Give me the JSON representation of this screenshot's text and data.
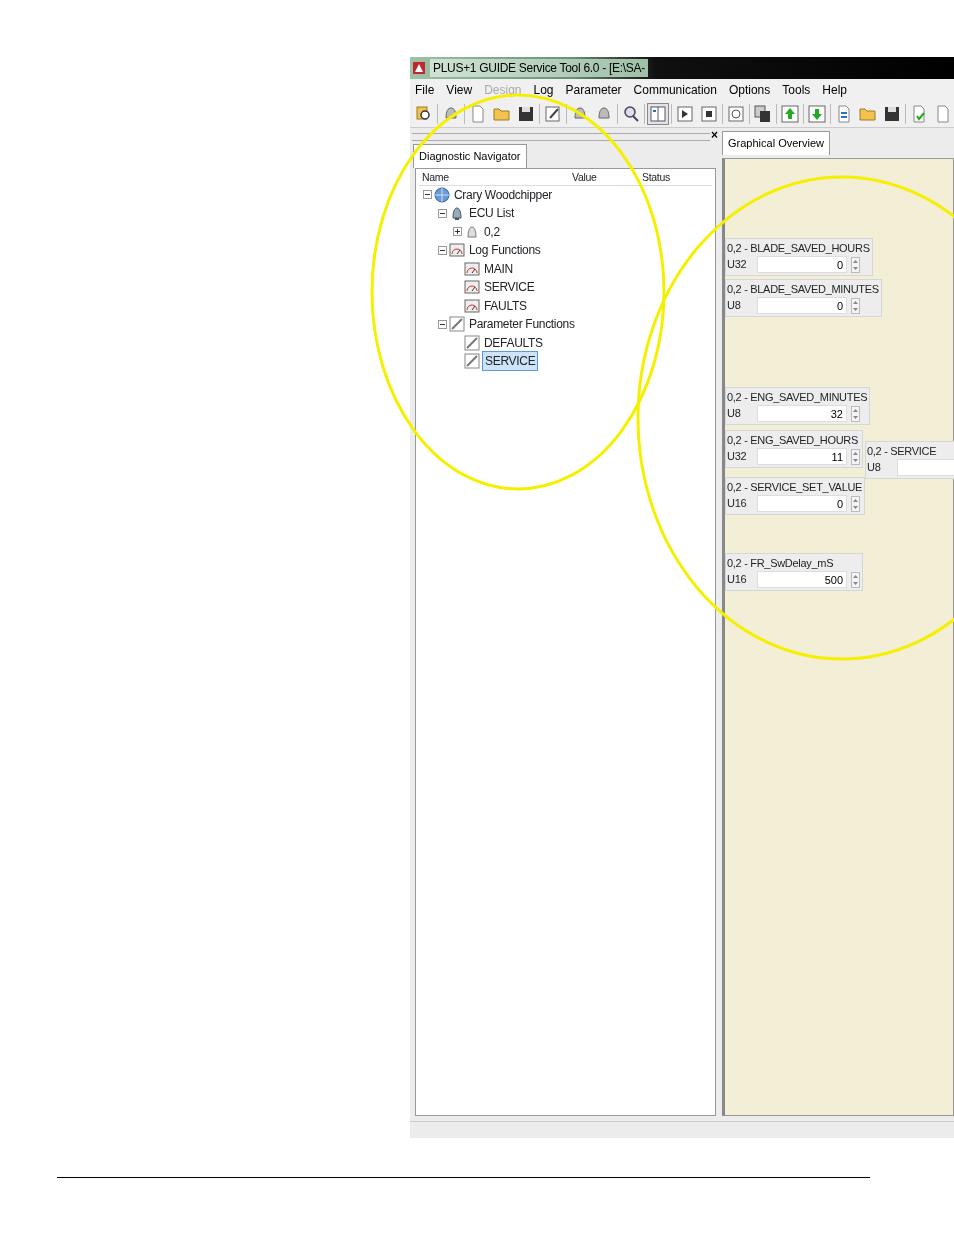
{
  "window": {
    "title": "PLUS+1 GUIDE Service Tool 6.0  - [E:\\SA-"
  },
  "menu": [
    {
      "label": "File",
      "disabled": false
    },
    {
      "label": "View",
      "disabled": false
    },
    {
      "label": "Design",
      "disabled": true
    },
    {
      "label": "Log",
      "disabled": false
    },
    {
      "label": "Parameter",
      "disabled": false
    },
    {
      "label": "Communication",
      "disabled": false
    },
    {
      "label": "Options",
      "disabled": false
    },
    {
      "label": "Tools",
      "disabled": false
    },
    {
      "label": "Help",
      "disabled": false
    }
  ],
  "navigator": {
    "tab": {
      "label": "Diagnostic Navigator",
      "selected": true
    },
    "close": "×",
    "columns": [
      "Name",
      "Value",
      "Status"
    ],
    "tree": [
      {
        "label": "Crary Woodchipper",
        "kind": "project",
        "expanded": true,
        "selected": false,
        "children": [
          {
            "label": "ECU List",
            "kind": "ecu_list",
            "expanded": true,
            "selected": false,
            "children": [
              {
                "label": "0,2",
                "kind": "ecu",
                "expanded": false,
                "selected": false
              }
            ]
          },
          {
            "label": "Log Functions",
            "kind": "log_group",
            "expanded": true,
            "selected": false,
            "children": [
              {
                "label": "MAIN",
                "kind": "log",
                "selected": false
              },
              {
                "label": "SERVICE",
                "kind": "log",
                "selected": false
              },
              {
                "label": "FAULTS",
                "kind": "log",
                "selected": false
              }
            ]
          },
          {
            "label": "Parameter Functions",
            "kind": "param_group",
            "expanded": true,
            "selected": false,
            "children": [
              {
                "label": "DEFAULTS",
                "kind": "param",
                "selected": false
              },
              {
                "label": "SERVICE",
                "kind": "param",
                "selected": true
              }
            ]
          }
        ]
      }
    ]
  },
  "overview": {
    "tab": {
      "label": "Graphical Overview",
      "selected": true
    },
    "parameters": [
      {
        "title": "0,2 - BLADE_SAVED_HOURS",
        "type": "U32",
        "value": "0"
      },
      {
        "title": "0,2 - BLADE_SAVED_MINUTES",
        "type": "U8",
        "value": "0"
      },
      {
        "title": "0,2 - ENG_SAVED_MINUTES",
        "type": "U8",
        "value": "32"
      },
      {
        "title": "0,2 - ENG_SAVED_HOURS",
        "type": "U32",
        "value": "11"
      },
      {
        "title": "0,2 - SERVICE_SET_VALUE",
        "type": "U16",
        "value": "0"
      },
      {
        "title": "0,2 - FR_SwDelay_mS",
        "type": "U16",
        "value": "500"
      },
      {
        "title": "0,2 - SERVICE",
        "type": "U8"
      }
    ]
  }
}
